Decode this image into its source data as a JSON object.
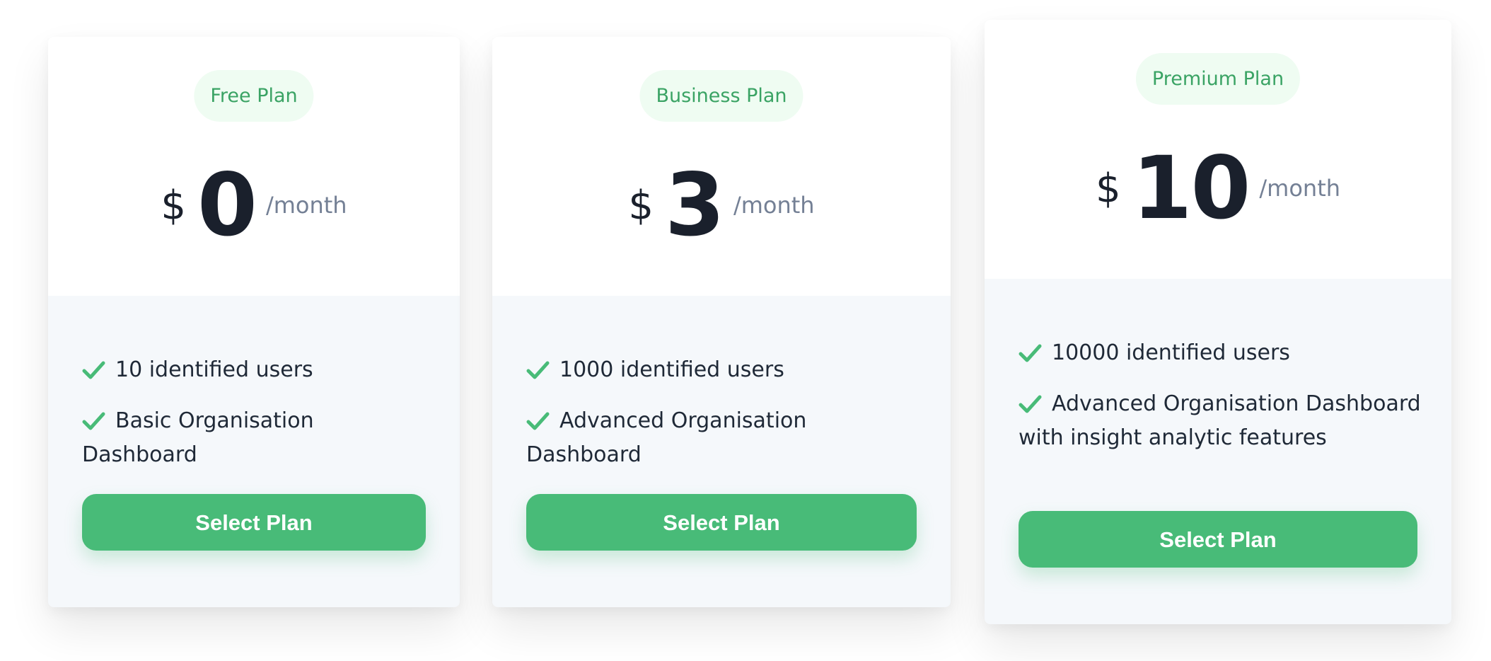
{
  "theme": {
    "accent": "#48bb78",
    "badge_text": "#3aa364",
    "badge_bg": "#effcf2",
    "card_body_bg": "#f5f8fb",
    "price_text": "#1a202c",
    "muted_text": "#748095"
  },
  "plans": [
    {
      "badge": "Free Plan",
      "currency": "$",
      "amount": "0",
      "period": "/month",
      "features": [
        "10 identified users",
        "Basic Organisation Dashboard"
      ],
      "feature_icon": "check-icon",
      "cta": "Select Plan"
    },
    {
      "badge": "Business Plan",
      "currency": "$",
      "amount": "3",
      "period": "/month",
      "features": [
        "1000 identified users",
        "Advanced Organisation Dashboard"
      ],
      "feature_icon": "check-icon",
      "cta": "Select Plan"
    },
    {
      "badge": "Premium Plan",
      "currency": "$",
      "amount": "10",
      "period": "/month",
      "features": [
        "10000 identified users",
        "Advanced Organisation Dashboard with insight analytic features"
      ],
      "feature_icon": "check-icon",
      "cta": "Select Plan"
    }
  ]
}
